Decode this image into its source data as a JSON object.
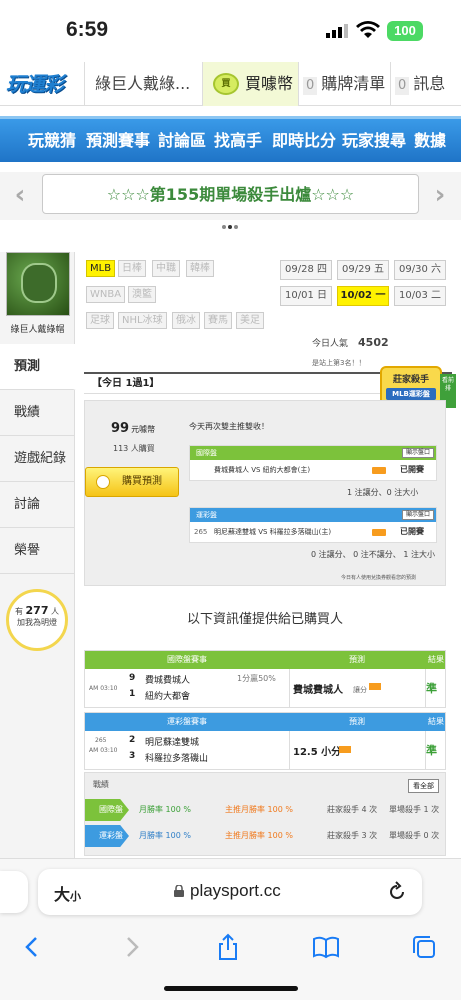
{
  "status": {
    "time": "6:59",
    "battery": "100"
  },
  "header": {
    "logo": "玩運彩",
    "title": "綠巨人戴綠...",
    "coin_icon_text": "買",
    "coins_label": "買噱幣",
    "orders_count": "0",
    "orders_label": "購牌清單",
    "msg_count": "0",
    "msg_label": "訊息"
  },
  "nav": [
    "玩競猜",
    "預測賽事",
    "討論區",
    "找高手",
    "即時比分",
    "玩家搜尋",
    "數據"
  ],
  "announcement": "☆☆☆第155期單場殺手出爐☆☆☆",
  "sidebar": {
    "username": "綠巨人戴綠帽",
    "items": [
      "預測",
      "戰績",
      "遊戲紀錄",
      "討論",
      "榮譽"
    ],
    "follow_prefix": "有",
    "follow_count": "277",
    "follow_suffix": "人",
    "follow_text": "加我為明燈"
  },
  "categories": [
    "MLB",
    "日棒",
    "中職",
    "韓棒",
    "WNBA",
    "澳籃",
    "足球",
    "NHL冰球",
    "俄冰",
    "賽馬",
    "美足"
  ],
  "dates": [
    "09/28 四",
    "09/29 五",
    "09/30 六",
    "10/01 日",
    "10/02 一",
    "10/03 二"
  ],
  "popularity": {
    "label": "今日人氣",
    "value": "4502",
    "rank": "是站上第3名！！"
  },
  "today": {
    "label": "【今日 1過1】",
    "price": "99",
    "price_unit": "元噱幣",
    "buyers": "113 人購買",
    "buy_button": "購買預測",
    "notice": "今天再次雙主推雙收！",
    "badge_line1": "莊家殺手",
    "badge_line2": "MLB運彩盤",
    "badge_tag": "看前排",
    "intl": {
      "title": "國際盤",
      "show": "顯示盤口",
      "match": "費城費城人 VS 紐約大都會(主)",
      "result": "已開賽",
      "summary": "1 注讓分、0 注大小"
    },
    "lottery": {
      "title": "運彩盤",
      "show": "顯示盤口",
      "code": "265",
      "match": "明尼蘇達雙城 VS 科羅拉多落磯山(主)",
      "result": "已開賽",
      "summary": "0 注讓分、 0 注不讓分、 1 注大小"
    },
    "footnote": "今日有人使用兌換券觀看您的預測"
  },
  "purchased_info": "以下資訊僅提供給已購買人",
  "results": [
    {
      "header": "國際盤賽事",
      "pick_header": "預測",
      "result_header": "結果",
      "time": "AM 03:10",
      "code": "",
      "team1_num": "9",
      "team1": "費城費城人",
      "team2_num": "1",
      "team2": "紐約大都會",
      "odds": "1分贏50%",
      "pick": "費城費城人",
      "pick_note": "讓分",
      "result": "準"
    },
    {
      "header": "運彩盤賽事",
      "pick_header": "預測",
      "result_header": "結果",
      "time": "AM 03:10",
      "code": "265",
      "team1_num": "2",
      "team1": "明尼蘇達雙城",
      "team2_num": "3",
      "team2": "科羅拉多落磯山",
      "odds": "",
      "pick": "12.5 小分",
      "pick_note": "",
      "result": "準"
    }
  ],
  "record": {
    "title": "戰績",
    "view_all": "看全部",
    "rows": [
      {
        "tag": "國際盤",
        "win_rate": "月勝率 100 %",
        "push_rate": "主推月勝率 100 %",
        "banker": "莊家殺手 4 次",
        "single": "單場殺手 1 次"
      },
      {
        "tag": "運彩盤",
        "win_rate": "月勝率 100 %",
        "push_rate": "主推月勝率 100 %",
        "banker": "莊家殺手 3 次",
        "single": "單場殺手 0 次"
      }
    ]
  },
  "browser": {
    "text_size": "大",
    "text_size_small": "小",
    "url": "playsport.cc"
  },
  "colors": {
    "green": "#7cc23b",
    "blue": "#3d9be0",
    "yellow": "#fff200"
  }
}
